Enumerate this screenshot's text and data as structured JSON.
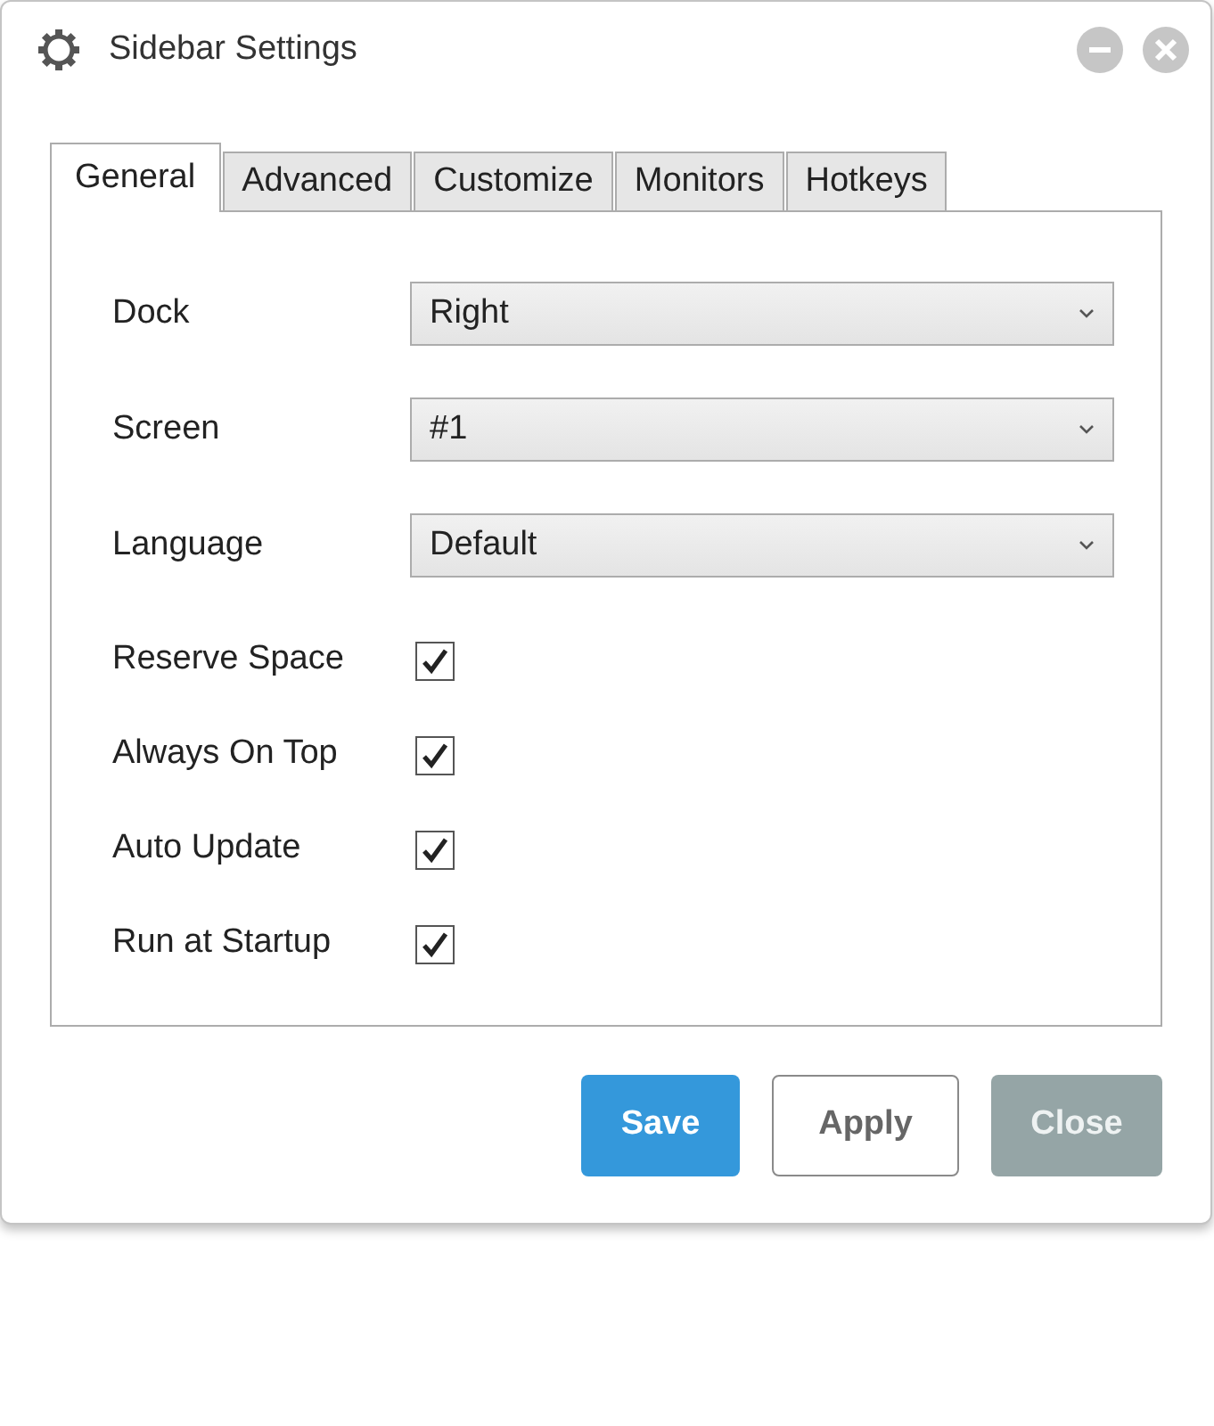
{
  "window": {
    "title": "Sidebar Settings",
    "controls": [
      {
        "kind": "minimize"
      },
      {
        "kind": "close"
      }
    ]
  },
  "tabs": [
    {
      "label": "General",
      "selected": true
    },
    {
      "label": "Advanced",
      "selected": false
    },
    {
      "label": "Customize",
      "selected": false
    },
    {
      "label": "Monitors",
      "selected": false
    },
    {
      "label": "Hotkeys",
      "selected": false
    }
  ],
  "settings": [
    {
      "kind": "dropdown",
      "label": "Dock",
      "value": "Right"
    },
    {
      "kind": "dropdown",
      "label": "Screen",
      "value": "#1"
    },
    {
      "kind": "dropdown",
      "label": "Language",
      "value": "Default"
    },
    {
      "kind": "checkbox",
      "label": "Reserve Space",
      "checked": true
    },
    {
      "kind": "checkbox",
      "label": "Always On Top",
      "checked": true
    },
    {
      "kind": "checkbox",
      "label": "Auto Update",
      "checked": true
    },
    {
      "kind": "checkbox",
      "label": "Run at Startup",
      "checked": true
    }
  ],
  "buttons": [
    {
      "label": "Save",
      "kind": "primary"
    },
    {
      "label": "Apply",
      "kind": "outline"
    },
    {
      "label": "Close",
      "kind": "secondary"
    }
  ]
}
